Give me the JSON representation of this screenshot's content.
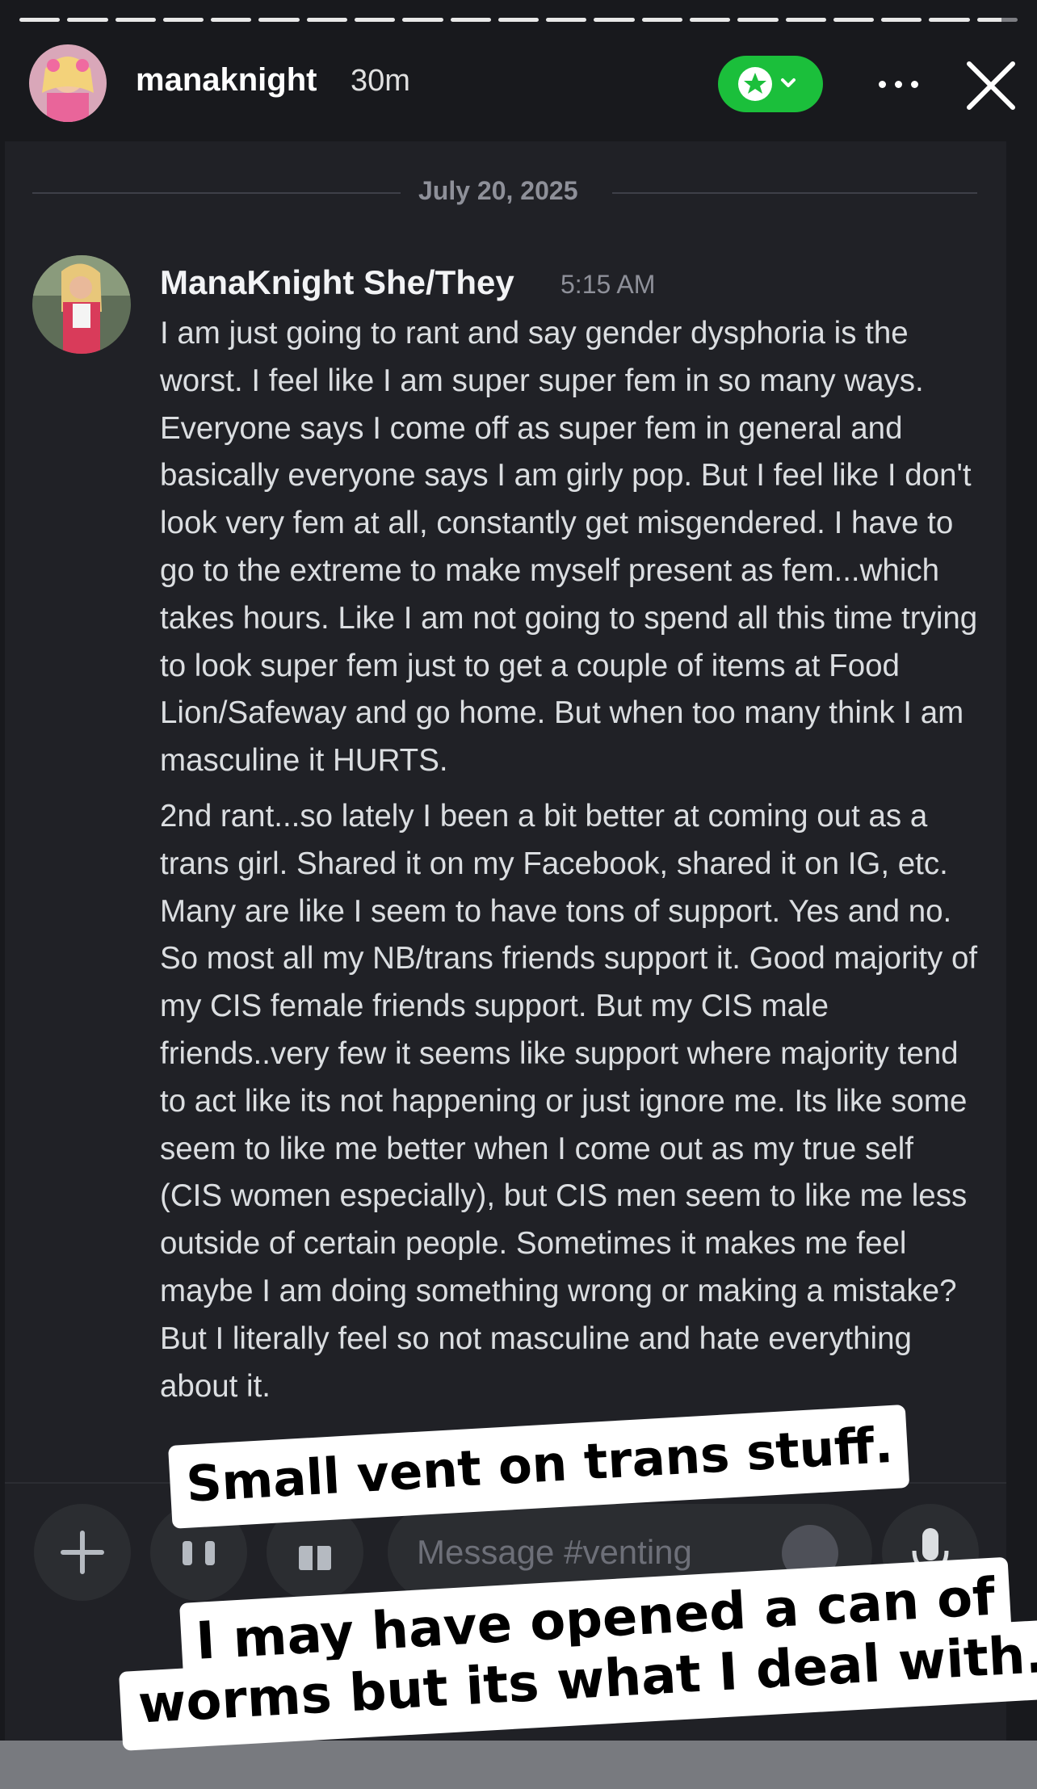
{
  "story": {
    "username": "manaknight",
    "time_ago": "30m",
    "progress_segments": 21,
    "active_segment": 21,
    "close_friends_color": "#1bbf3b",
    "icons": [
      "star-icon",
      "chevron-down-icon",
      "more-icon",
      "close-icon"
    ]
  },
  "chat": {
    "date_divider": "July 20, 2025",
    "message": {
      "author": "ManaKnight She/They",
      "time": "5:15 AM",
      "paragraphs": [
        "I am just going to rant and say gender dysphoria is the worst.   I feel like I am super super fem in so many ways. Everyone says I come off as super fem in general and basically everyone says I am girly pop.  But I feel like I don't look very fem at all, constantly get misgendered.  I have to go to the extreme to make myself present as fem...which takes hours.  Like I am not going to spend all this time trying to look super fem just to get a couple of items at Food Lion/Safeway and go home.   But when too many think I am masculine it HURTS.",
        "2nd rant...so lately I been a bit better at coming out as a trans girl.  Shared it on my Facebook, shared it on IG, etc.  Many are like I seem to have tons of support.  Yes and no.  So most all my NB/trans friends support it.  Good majority of my CIS female friends support.  But my CIS male friends..very few it seems like support where majority tend to act like its not happening or just ignore me.  Its like some seem to like me better when I come out as my true self (CIS women especially), but CIS men seem to like me less outside of certain people. Sometimes it makes me feel maybe I am doing something wrong or making a mistake?  But I literally feel so not masculine and hate everything about it."
      ]
    },
    "composer": {
      "placeholder": "Message #venting",
      "icons": [
        "plus-icon",
        "apps-icon",
        "gift-icon",
        "emoji-icon",
        "microphone-icon"
      ]
    }
  },
  "captions": {
    "line1": "Small vent on trans stuff.",
    "line2": "I may have opened a can of",
    "line3": "worms but its what I deal with."
  }
}
